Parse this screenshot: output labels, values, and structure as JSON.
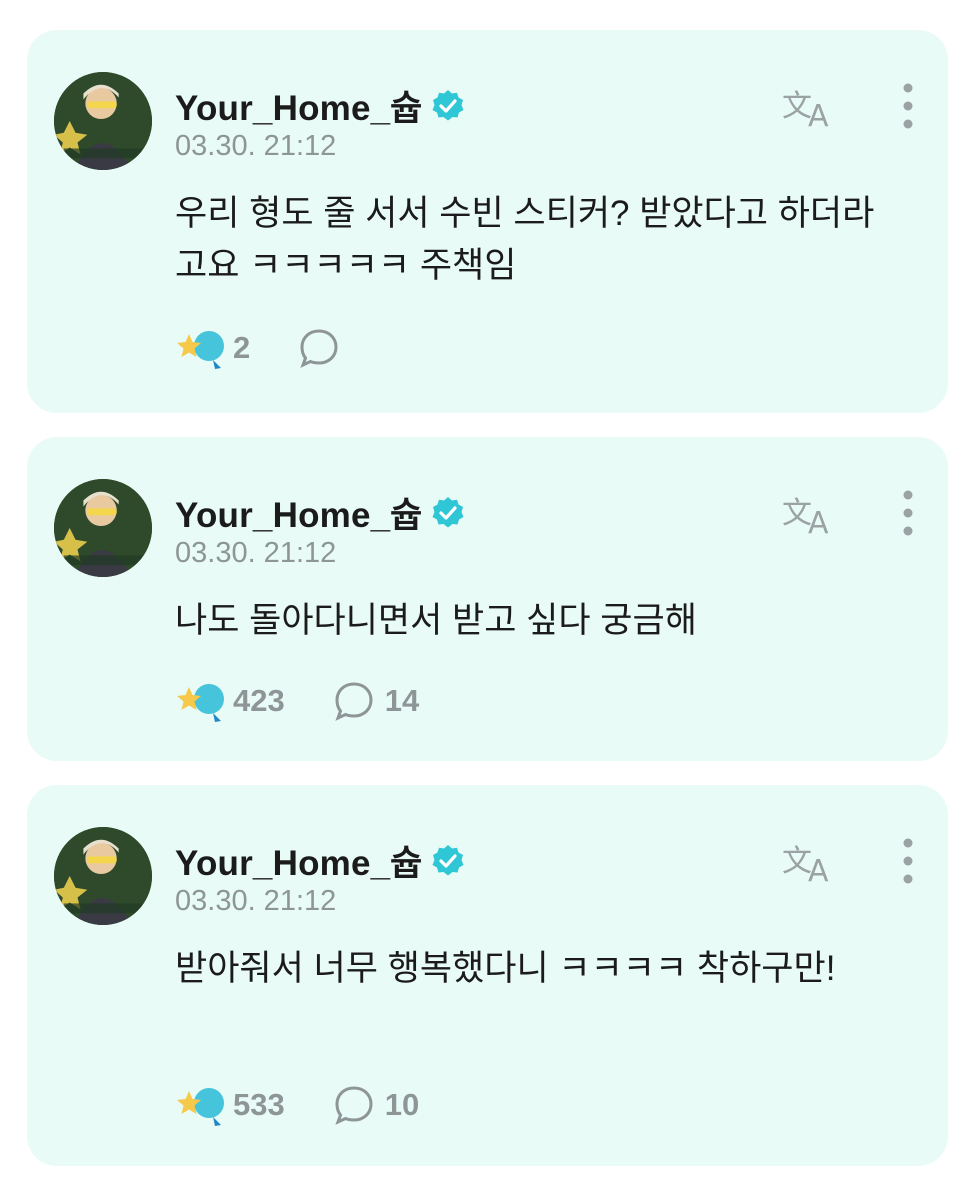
{
  "posts": [
    {
      "author": "Your_Home_슙",
      "time": "03.30. 21:12",
      "text": "우리 형도 줄 서서 수빈 스티커? 받았다고 하더라고요 ㅋㅋㅋㅋㅋ 주책임",
      "reactions": "2",
      "comments": ""
    },
    {
      "author": "Your_Home_슙",
      "time": "03.30. 21:12",
      "text": "나도 돌아다니면서 받고 싶다 궁금해",
      "reactions": "423",
      "comments": "14"
    },
    {
      "author": "Your_Home_슙",
      "time": "03.30. 21:12",
      "text": "받아줘서 너무 행복했다니 ㅋㅋㅋㅋ 착하구만!",
      "reactions": "533",
      "comments": "10"
    }
  ],
  "icons": {
    "verified": "verified-badge-icon",
    "translate": "translate-icon",
    "more": "more-vertical-icon",
    "reaction": "star-lightbulb-reaction-icon",
    "comment": "speech-bubble-icon"
  },
  "colors": {
    "card_background": "#e8fbf6",
    "verified": "#2fc6d6",
    "muted_text": "#8e9596"
  }
}
